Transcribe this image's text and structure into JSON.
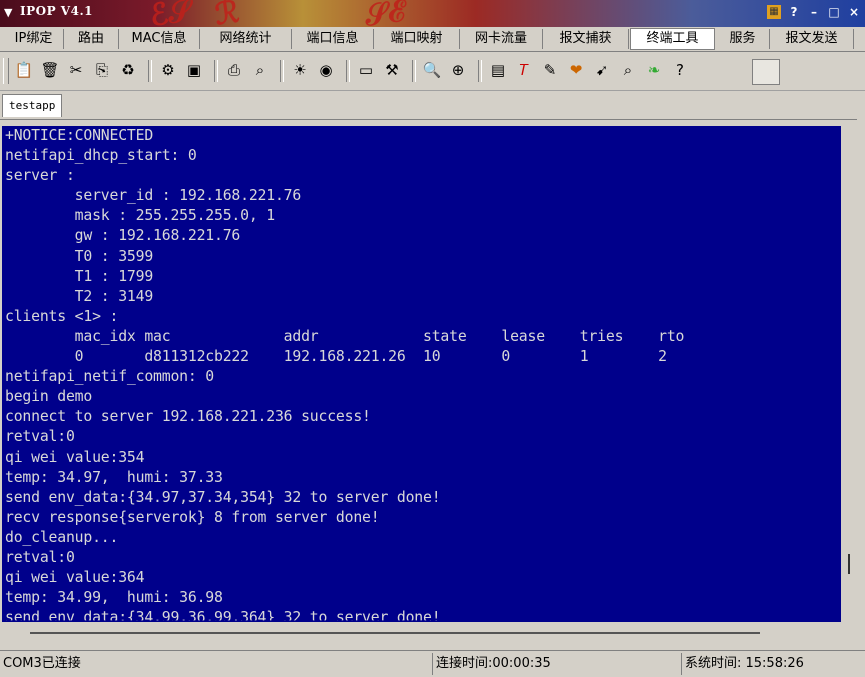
{
  "window": {
    "title": "IPOP V4.1",
    "controls": [
      "?",
      "–",
      "□",
      "×"
    ]
  },
  "menu": {
    "items": [
      "IP绑定",
      "路由",
      "MAC信息",
      "网络统计",
      "端口信息",
      "端口映射",
      "网卡流量",
      "报文捕获",
      "终端工具",
      "服务",
      "报文发送"
    ],
    "active": "终端工具"
  },
  "toolbar": {
    "icons": [
      "open-icon",
      "trash-icon",
      "cut-icon",
      "copy-icon",
      "paste-icon",
      "connect-icon",
      "disconnect-icon",
      "print-icon",
      "find-icon",
      "sun-icon",
      "record-icon",
      "terminal-icon",
      "settings-icon",
      "zoom-in-icon",
      "target-icon",
      "calendar-icon",
      "font-icon",
      "tools-icon",
      "heart-icon",
      "arrow-icon",
      "zoom-icon",
      "leaf-icon",
      "help-icon"
    ]
  },
  "tabs": [
    "testapp"
  ],
  "terminal": {
    "lines": [
      "+NOTICE:CONNECTED",
      "netifapi_dhcp_start: 0",
      "server :",
      "        server_id : 192.168.221.76",
      "        mask : 255.255.255.0, 1",
      "        gw : 192.168.221.76",
      "        T0 : 3599",
      "        T1 : 1799",
      "        T2 : 3149",
      "clients <1> :",
      "        mac_idx mac             addr            state    lease    tries    rto",
      "        0       d811312cb222    192.168.221.26  10       0        1        2",
      "netifapi_netif_common: 0",
      "begin demo",
      "connect to server 192.168.221.236 success!",
      "retval:0",
      "qi wei value:354",
      "temp: 34.97,  humi: 37.33",
      "send env_data:{34.97,37.34,354} 32 to server done!",
      "recv response{serverok} 8 from server done!",
      "do_cleanup...",
      "retval:0",
      "qi wei value:364",
      "temp: 34.99,  humi: 36.98",
      "send env_data:{34.99,36.99,364} 32 to server done!"
    ]
  },
  "status": {
    "port": "COM3已连接",
    "connect_time": "连接时间:00:00:35",
    "system_time": "系统时间: 15:58:26"
  },
  "colors": {
    "terminal_bg": "#00008b",
    "terminal_fg": "#d8d8d8",
    "chrome": "#d4d0c8"
  }
}
